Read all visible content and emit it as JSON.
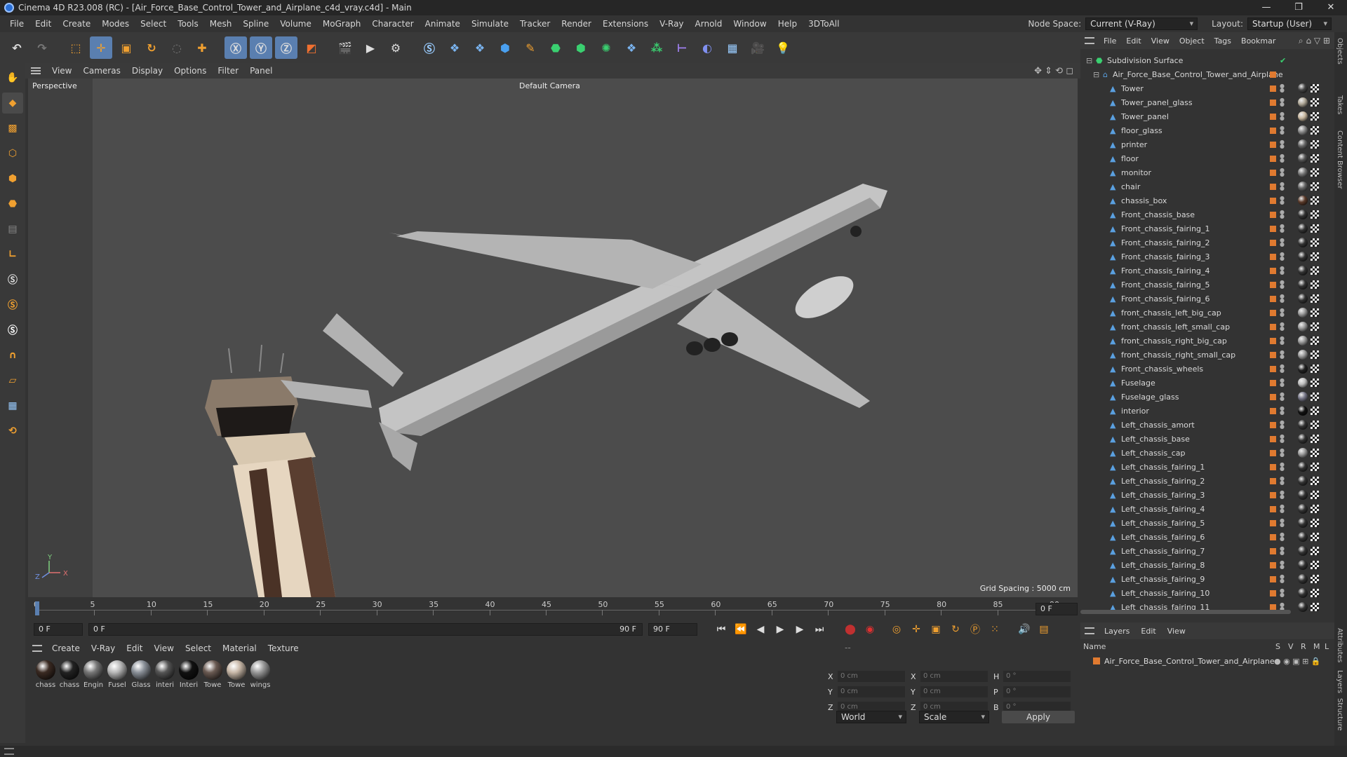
{
  "window": {
    "title": "Cinema 4D R23.008 (RC) - [Air_Force_Base_Control_Tower_and_Airplane_c4d_vray.c4d] - Main"
  },
  "menu": [
    "File",
    "Edit",
    "Create",
    "Modes",
    "Select",
    "Tools",
    "Mesh",
    "Spline",
    "Volume",
    "MoGraph",
    "Character",
    "Animate",
    "Simulate",
    "Tracker",
    "Render",
    "Extensions",
    "V-Ray",
    "Arnold",
    "Window",
    "Help",
    "3DToAll"
  ],
  "nodespace": {
    "label": "Node Space:",
    "value": "Current (V-Ray)"
  },
  "layout": {
    "label": "Layout:",
    "value": "Startup (User)"
  },
  "viewport": {
    "menu": [
      "View",
      "Cameras",
      "Display",
      "Options",
      "Filter",
      "Panel"
    ],
    "projection": "Perspective",
    "camera": "Default Camera",
    "grid_spacing": "Grid Spacing : 5000 cm"
  },
  "timeline": {
    "ticks": [
      "0",
      "5",
      "10",
      "15",
      "20",
      "25",
      "30",
      "35",
      "40",
      "45",
      "50",
      "55",
      "60",
      "65",
      "70",
      "75",
      "80",
      "85",
      "90"
    ],
    "current_frame": "0 F",
    "start": "0 F",
    "range_start": "0 F",
    "range_end": "90 F",
    "end": "90 F",
    "end2": "0 F"
  },
  "material_panel": {
    "menu": [
      "Create",
      "V-Ray",
      "Edit",
      "View",
      "Select",
      "Material",
      "Texture"
    ],
    "materials": [
      {
        "name": "chass",
        "color": "#3a2a22"
      },
      {
        "name": "chass",
        "color": "#222222"
      },
      {
        "name": "Engin",
        "color": "#777777"
      },
      {
        "name": "Fusel",
        "color": "#b8b8b8"
      },
      {
        "name": "Glass",
        "color": "#8a9098"
      },
      {
        "name": "interi",
        "color": "#555555"
      },
      {
        "name": "Interi",
        "color": "#111111"
      },
      {
        "name": "Towe",
        "color": "#6a5a52"
      },
      {
        "name": "Towe",
        "color": "#c8b8a8"
      },
      {
        "name": "wings",
        "color": "#999999"
      }
    ]
  },
  "coords": {
    "rows": [
      {
        "a": "X",
        "v1": "0 cm",
        "b": "X",
        "v2": "0 cm",
        "c": "H",
        "v3": "0 °"
      },
      {
        "a": "Y",
        "v1": "0 cm",
        "b": "Y",
        "v2": "0 cm",
        "c": "P",
        "v3": "0 °"
      },
      {
        "a": "Z",
        "v1": "0 cm",
        "b": "Z",
        "v2": "0 cm",
        "c": "B",
        "v3": "0 °"
      }
    ],
    "mode1": "World",
    "mode2": "Scale",
    "apply": "Apply"
  },
  "objects_panel": {
    "menu": [
      "File",
      "Edit",
      "View",
      "Object",
      "Tags",
      "Bookmar"
    ],
    "root": "Subdivision Surface",
    "group": "Air_Force_Base_Control_Tower_and_Airplane",
    "items": [
      {
        "name": "Tower",
        "ball": "#444"
      },
      {
        "name": "Tower_panel_glass",
        "ball": "#b0a898"
      },
      {
        "name": "Tower_panel",
        "ball": "#c8b8a0"
      },
      {
        "name": "floor_glass",
        "ball": "#888"
      },
      {
        "name": "printer",
        "ball": "#666"
      },
      {
        "name": "floor",
        "ball": "#555"
      },
      {
        "name": "monitor",
        "ball": "#777"
      },
      {
        "name": "chair",
        "ball": "#666"
      },
      {
        "name": "chassis_box",
        "ball": "#5a3a2a"
      },
      {
        "name": "Front_chassis_base",
        "ball": "#333"
      },
      {
        "name": "Front_chassis_fairing_1",
        "ball": "#333"
      },
      {
        "name": "Front_chassis_fairing_2",
        "ball": "#333"
      },
      {
        "name": "Front_chassis_fairing_3",
        "ball": "#333"
      },
      {
        "name": "Front_chassis_fairing_4",
        "ball": "#333"
      },
      {
        "name": "Front_chassis_fairing_5",
        "ball": "#333"
      },
      {
        "name": "Front_chassis_fairing_6",
        "ball": "#333"
      },
      {
        "name": "front_chassis_left_big_cap",
        "ball": "#999"
      },
      {
        "name": "front_chassis_left_small_cap",
        "ball": "#999"
      },
      {
        "name": "front_chassis_right_big_cap",
        "ball": "#999"
      },
      {
        "name": "front_chassis_right_small_cap",
        "ball": "#999"
      },
      {
        "name": "Front_chassis_wheels",
        "ball": "#222"
      },
      {
        "name": "Fuselage",
        "ball": "#bbb"
      },
      {
        "name": "Fuselage_glass",
        "ball": "#778"
      },
      {
        "name": "interior",
        "ball": "#111"
      },
      {
        "name": "Left_chassis_amort",
        "ball": "#333"
      },
      {
        "name": "Left_chassis_base",
        "ball": "#333"
      },
      {
        "name": "Left_chassis_cap",
        "ball": "#999"
      },
      {
        "name": "Left_chassis_fairing_1",
        "ball": "#333"
      },
      {
        "name": "Left_chassis_fairing_2",
        "ball": "#333"
      },
      {
        "name": "Left_chassis_fairing_3",
        "ball": "#333"
      },
      {
        "name": "Left_chassis_fairing_4",
        "ball": "#333"
      },
      {
        "name": "Left_chassis_fairing_5",
        "ball": "#333"
      },
      {
        "name": "Left_chassis_fairing_6",
        "ball": "#333"
      },
      {
        "name": "Left_chassis_fairing_7",
        "ball": "#333"
      },
      {
        "name": "Left_chassis_fairing_8",
        "ball": "#333"
      },
      {
        "name": "Left_chassis_fairing_9",
        "ball": "#333"
      },
      {
        "name": "Left_chassis_fairing_10",
        "ball": "#333"
      },
      {
        "name": "Left_chassis_fairing_11",
        "ball": "#333"
      }
    ]
  },
  "layers_panel": {
    "menu": [
      "Layers",
      "Edit",
      "View"
    ],
    "header_name": "Name",
    "header_cols": [
      "S",
      "V",
      "R",
      "M",
      "L"
    ],
    "layer": "Air_Force_Base_Control_Tower_and_Airplane"
  },
  "side_tabs": [
    "Objects",
    "Takes",
    "Content Browser",
    "Attributes",
    "Layers",
    "Structure"
  ],
  "colors": {
    "accent": "#5a7fb0",
    "tag_orange": "#e07a30",
    "viewport_bg": "#4c4c4c"
  }
}
